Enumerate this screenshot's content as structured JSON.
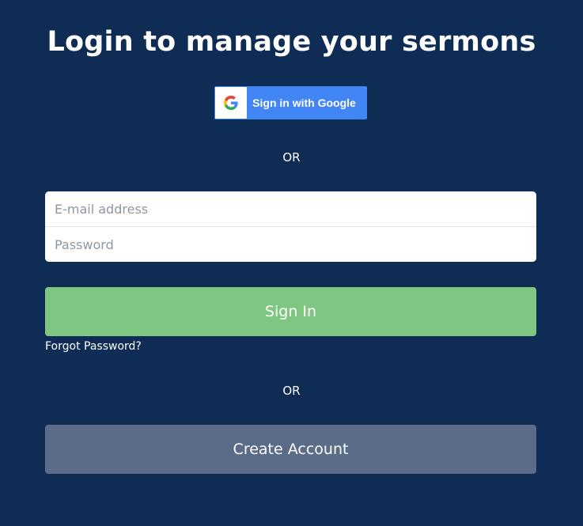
{
  "page": {
    "title": "Login to manage your sermons",
    "background_color": "#0f2c54"
  },
  "google": {
    "label": "Sign in with Google",
    "icon": "google-g-icon",
    "color": "#4285f4"
  },
  "divider": {
    "or_text_1": "OR",
    "or_text_2": "OR"
  },
  "form": {
    "email_placeholder": "E-mail address",
    "email_value": "",
    "password_placeholder": "Password",
    "password_value": ""
  },
  "actions": {
    "sign_in_label": "Sign In",
    "sign_in_color": "#80c683",
    "forgot_password_label": "Forgot Password?",
    "create_account_label": "Create Account",
    "create_account_color": "#5a6c87"
  }
}
